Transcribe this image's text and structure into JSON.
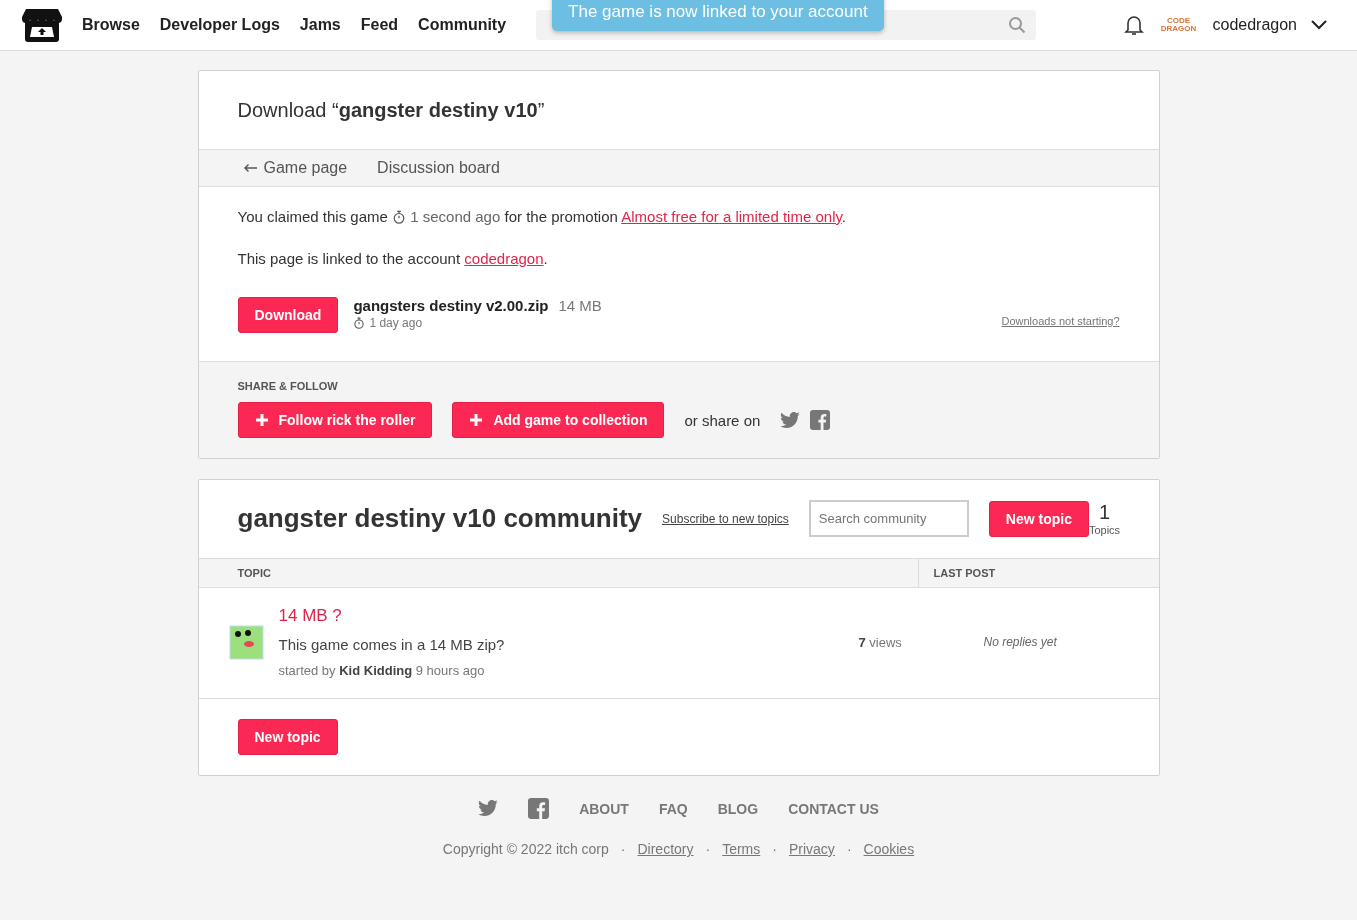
{
  "header": {
    "nav": [
      "Browse",
      "Developer Logs",
      "Jams",
      "Feed",
      "Community"
    ],
    "toast": "The game is now linked to your account",
    "avatar_text": "CODE DRAGON",
    "username": "codedragon"
  },
  "download": {
    "title": "Download “**gangster destiny v10**”",
    "tabs": [
      {
        "label": "Game page",
        "kind": "back"
      },
      {
        "label": "Discussion board",
        "kind": "plain"
      }
    ],
    "claim": {
      "before": "You claimed this game",
      "time": "1 second ago",
      "middle": "for the promotion",
      "link": "Almost free for a limited time only",
      "after": "."
    },
    "linked": {
      "before": "This page is linked to the account",
      "link": "codedragon",
      "after": "."
    },
    "file": {
      "button": "Download",
      "name": "gangsters destiny v2.00.zip",
      "size": "14 MB",
      "age": "1 day ago"
    },
    "help_link": "Downloads not starting?",
    "share": {
      "heading": "SHARE & FOLLOW",
      "buttons": [
        "Follow rick the roller",
        "Add game to collection"
      ],
      "share_label": "or share on"
    }
  },
  "community": {
    "title": "gangster destiny v10 community",
    "subscribe": "Subscribe to new topics",
    "search": {
      "placeholder": "Search community"
    },
    "new_topic": "New topic",
    "count": "1",
    "count_label": "Topics",
    "columns": [
      "TOPIC",
      "LAST POST"
    ],
    "topics": [
      {
        "title": "14 MB ?",
        "excerpt": "This game comes in a 14 MB zip?",
        "started_by": "started by",
        "author": "Kid Kidding",
        "time": "9 hours ago",
        "views": "7",
        "views_label": "views",
        "last_post": "No replies yet"
      }
    ],
    "bottom_button": "New topic"
  },
  "footer": {
    "links": [
      "ABOUT",
      "FAQ",
      "BLOG",
      "CONTACT US"
    ],
    "separator": "·",
    "copyright": "Copyright © 2022 itch corp",
    "legal": [
      "Directory",
      "Terms",
      "Privacy",
      "Cookies"
    ]
  }
}
